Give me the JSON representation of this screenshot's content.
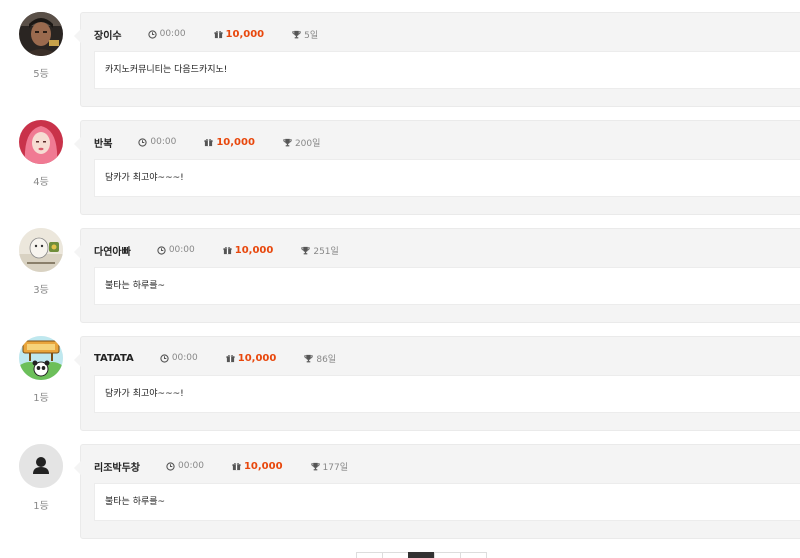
{
  "entries": [
    {
      "name": "장이수",
      "rank": "5등",
      "time": "00:00",
      "points": "10,000",
      "days": "5일",
      "message": "카지노커뮤니티는 다음드카지노!",
      "avatar": "person-photo"
    },
    {
      "name": "반복",
      "rank": "4등",
      "time": "00:00",
      "points": "10,000",
      "days": "200일",
      "message": "담카가 최고야~~~!",
      "avatar": "pink-hair-photo"
    },
    {
      "name": "다연아빠",
      "rank": "3등",
      "time": "00:00",
      "points": "10,000",
      "days": "251일",
      "message": "불타는 하루를~",
      "avatar": "cartoon-image"
    },
    {
      "name": "TATATA",
      "rank": "1등",
      "time": "00:00",
      "points": "10,000",
      "days": "86일",
      "message": "담카가 최고야~~~!",
      "avatar": "panda-sign-image"
    },
    {
      "name": "리조박두창",
      "rank": "1등",
      "time": "00:00",
      "points": "10,000",
      "days": "177일",
      "message": "불타는 하루를~",
      "avatar": "default-user-icon"
    }
  ],
  "icons": {
    "time": "clock-icon",
    "points": "gift-icon",
    "days": "trophy-icon"
  },
  "colors": {
    "points": "#e8470c",
    "card_bg": "#f4f4f4",
    "active_page": "#333333"
  },
  "pagination": {
    "active_index": 2,
    "count": 5
  }
}
